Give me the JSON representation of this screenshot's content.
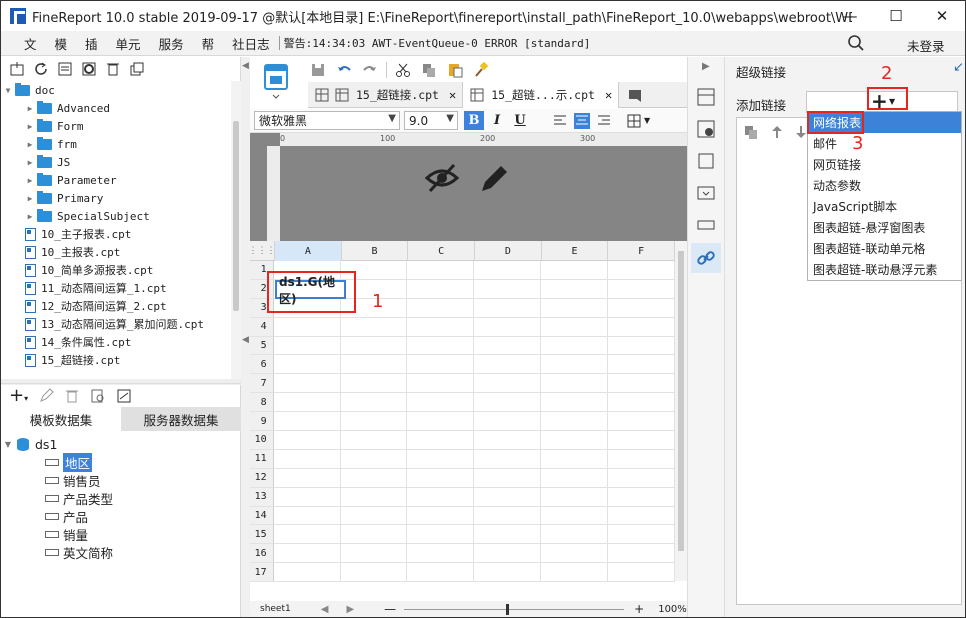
{
  "window": {
    "title": "FineReport 10.0 stable 2019-09-17 @默认[本地目录]    E:\\FineReport\\finereport\\install_path\\FineReport_10.0\\webapps\\webroot\\WEB-INF...",
    "minimize": "—",
    "maximize": "☐",
    "close": "✕"
  },
  "menubar": {
    "items": [
      "文",
      "模",
      "插",
      "单元",
      "服务",
      "帮",
      "社日志"
    ],
    "log": "警告:14:34:03 AWT-EventQueue-0 ERROR [standard]",
    "login": "未登录"
  },
  "tree": {
    "root": "doc",
    "folders": [
      "Advanced",
      "Form",
      "frm",
      "JS",
      "Parameter",
      "Primary",
      "SpecialSubject"
    ],
    "files": [
      "10_主子报表.cpt",
      "10_主报表.cpt",
      "10_简单多源报表.cpt",
      "11_动态隔间运算_1.cpt",
      "12_动态隔间运算_2.cpt",
      "13_动态隔间运算_累加问题.cpt",
      "14_条件属性.cpt",
      "15_超链接.cpt"
    ]
  },
  "dataset": {
    "tabs": [
      "模板数据集",
      "服务器数据集"
    ],
    "name": "ds1",
    "fields": [
      "地区",
      "销售员",
      "产品类型",
      "产品",
      "销量",
      "英文简称"
    ]
  },
  "editor": {
    "tabs": [
      {
        "label": "15_超链接.cpt",
        "close": "✕"
      },
      {
        "label": "15_超链...示.cpt",
        "close": "✕"
      }
    ],
    "font": "微软雅黑",
    "size": "9.0",
    "bold": "B",
    "italic": "I",
    "underline": "U",
    "ruler": [
      "0",
      "100",
      "200",
      "300"
    ],
    "columns": [
      "A",
      "B",
      "C",
      "D",
      "E",
      "F"
    ],
    "rows": [
      "1",
      "2",
      "3",
      "4",
      "5",
      "6",
      "7",
      "8",
      "9",
      "10",
      "11",
      "12",
      "13",
      "14",
      "15",
      "16",
      "17"
    ],
    "cell_a2": "ds1.G(地区)",
    "zoom": "100%",
    "sheet": "sheet1"
  },
  "right": {
    "title": "超级链接",
    "add_label": "添加链接",
    "plus": "+",
    "menu": [
      "网络报表",
      "邮件",
      "网页链接",
      "动态参数",
      "JavaScript脚本",
      "图表超链-悬浮窗图表",
      "图表超链-联动单元格",
      "图表超链-联动悬浮元素"
    ]
  },
  "annotations": [
    "1",
    "2",
    "3"
  ],
  "colors": {
    "accent": "#3b82d8",
    "annotation": "#e5261e"
  }
}
